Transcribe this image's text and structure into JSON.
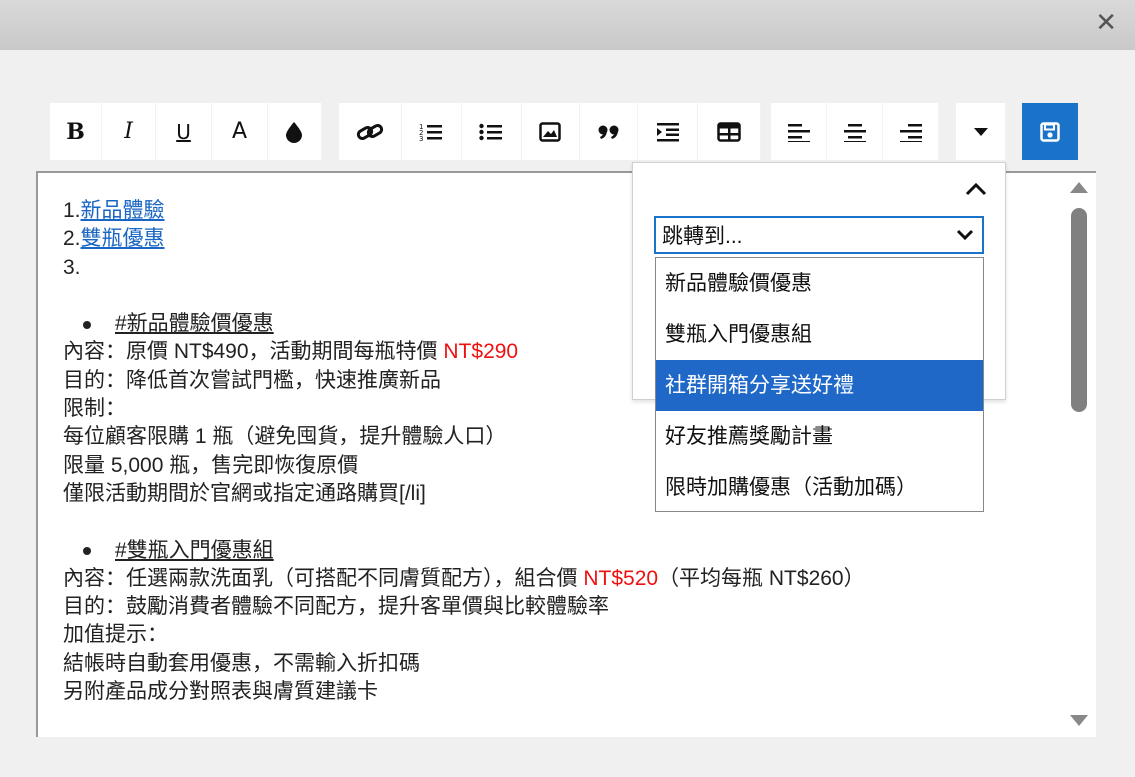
{
  "window": {
    "close_glyph": "✕"
  },
  "toolbar": {
    "buttons": [
      {
        "name": "bold",
        "icon": "bold-icon"
      },
      {
        "name": "italic",
        "icon": "italic-icon"
      },
      {
        "name": "underline",
        "icon": "underline-icon"
      },
      {
        "name": "font-color",
        "icon": "text-color-icon"
      },
      {
        "name": "background-color",
        "icon": "droplet-icon"
      },
      {
        "name": "link",
        "icon": "link-icon"
      },
      {
        "name": "ordered-list",
        "icon": "ordered-list-icon"
      },
      {
        "name": "unordered-list",
        "icon": "unordered-list-icon"
      },
      {
        "name": "image",
        "icon": "image-icon"
      },
      {
        "name": "blockquote",
        "icon": "quote-icon"
      },
      {
        "name": "indent",
        "icon": "indent-icon"
      },
      {
        "name": "table",
        "icon": "table-icon"
      },
      {
        "name": "align-left",
        "icon": "align-left-icon"
      },
      {
        "name": "align-center",
        "icon": "align-center-icon"
      },
      {
        "name": "align-right",
        "icon": "align-right-icon"
      },
      {
        "name": "more",
        "icon": "caret-down-icon"
      },
      {
        "name": "save",
        "icon": "save-icon"
      }
    ],
    "labels": {
      "bold": "B",
      "italic": "I",
      "underline": "U",
      "font_color": "A"
    },
    "accent_color": "#1a73c8"
  },
  "editor": {
    "toc": [
      {
        "num": "1.",
        "link": "新品體驗"
      },
      {
        "num": "2.",
        "link": "雙瓶優惠"
      },
      {
        "num": "3.",
        "link": ""
      }
    ],
    "section1": {
      "heading": "#新品體驗價優惠",
      "content_prefix": "內容：原價 NT$490，活動期間每瓶特價 ",
      "content_price": "NT$290",
      "purpose": "目的：降低首次嘗試門檻，快速推廣新品",
      "limit_label": "限制：",
      "lines": [
        "每位顧客限購 1 瓶（避免囤貨，提升體驗人口）",
        "限量 5,000 瓶，售完即恢復原價",
        "僅限活動期間於官網或指定通路購買[/li]"
      ]
    },
    "section2": {
      "heading": "#雙瓶入門優惠組",
      "content_prefix": "內容：任選兩款洗面乳（可搭配不同膚質配方），組合價 ",
      "content_price": "NT$520",
      "content_suffix": "（平均每瓶 NT$260）",
      "purpose": "目的：鼓勵消費者體驗不同配方，提升客單價與比較體驗率",
      "bonus_label": "加值提示：",
      "lines": [
        "結帳時自動套用優惠，不需輸入折扣碼",
        "另附產品成分對照表與膚質建議卡"
      ]
    },
    "price_color": "#ee1111",
    "link_color": "#1a66c4"
  },
  "navigator": {
    "select_value": "跳轉到...",
    "options": [
      "新品體驗價優惠",
      "雙瓶入門優惠組",
      "社群開箱分享送好禮",
      "好友推薦獎勵計畫",
      "限時加購優惠（活動加碼）"
    ],
    "selected_index": 2,
    "highlight_color": "#2068c8"
  }
}
